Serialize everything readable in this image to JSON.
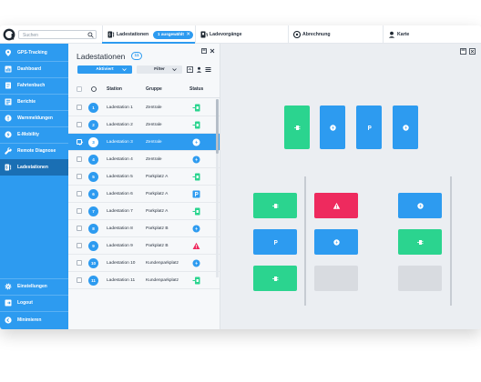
{
  "colors": {
    "accent": "#2d9bf0",
    "accent_dark": "#1a6fb4",
    "green": "#2bd48f",
    "red": "#ee2a5e",
    "gray": "#d8dbe0"
  },
  "topbar": {
    "search_placeholder": "Suchen",
    "tabs": [
      {
        "label": "Ladestationen",
        "icon": "charger-icon",
        "badge": "1 ausgewählt"
      },
      {
        "label": "Ladevorgänge",
        "icon": "plug-icon"
      },
      {
        "label": "Abrechnung",
        "icon": "coin-icon"
      },
      {
        "label": "Karte",
        "icon": "map-pin-icon"
      }
    ]
  },
  "sidebar": {
    "items": [
      {
        "label": "GPS-Tracking",
        "icon": "location-pin-icon"
      },
      {
        "label": "Dashboard",
        "icon": "dashboard-icon"
      },
      {
        "label": "Fahrtenbuch",
        "icon": "logbook-icon"
      },
      {
        "label": "Berichte",
        "icon": "report-icon"
      },
      {
        "label": "Warnmeldungen",
        "icon": "alert-icon"
      },
      {
        "label": "E-Mobility",
        "icon": "lightning-icon"
      },
      {
        "label": "Remote Diagnose",
        "icon": "wrench-icon"
      },
      {
        "label": "Ladestationen",
        "icon": "charger-icon",
        "active": true
      }
    ],
    "bottom": [
      {
        "label": "Einstellungen",
        "icon": "gear-icon"
      },
      {
        "label": "Logout",
        "icon": "logout-icon"
      },
      {
        "label": "Minimieren",
        "icon": "collapse-icon"
      }
    ]
  },
  "panel": {
    "title": "Ladestationen",
    "count": "11",
    "filter_active": "Aktiviert",
    "filter": "Filter",
    "columns": {
      "station": "Station",
      "gruppe": "Gruppe",
      "status": "Status"
    },
    "rows": [
      {
        "num": "1",
        "station": "Ladestation 1",
        "gruppe": "Zentrale",
        "status": "green"
      },
      {
        "num": "2",
        "station": "Ladestation 2",
        "gruppe": "Zentrale",
        "status": "green"
      },
      {
        "num": "3",
        "station": "Ladestation 3",
        "gruppe": "Zentrale",
        "status": "blue",
        "selected": true
      },
      {
        "num": "4",
        "station": "Ladestation 4",
        "gruppe": "Zentrale",
        "status": "blue"
      },
      {
        "num": "5",
        "station": "Ladestation 5",
        "gruppe": "Parkplatz A",
        "status": "green"
      },
      {
        "num": "6",
        "station": "Ladestation 6",
        "gruppe": "Parkplatz A",
        "status": "blue-p"
      },
      {
        "num": "7",
        "station": "Ladestation 7",
        "gruppe": "Parkplatz A",
        "status": "green"
      },
      {
        "num": "8",
        "station": "Ladestation 8",
        "gruppe": "Parkplatz B",
        "status": "blue"
      },
      {
        "num": "9",
        "station": "Ladestation 9",
        "gruppe": "Parkplatz B",
        "status": "red"
      },
      {
        "num": "10",
        "station": "Ladestation 10",
        "gruppe": "Kundenparkplatz",
        "status": "blue"
      },
      {
        "num": "11",
        "station": "Ladestation 11",
        "gruppe": "Kundenparkplatz",
        "status": "green"
      }
    ]
  },
  "map": {
    "spots": [
      {
        "name": "map-spot-green-top",
        "status": "green"
      },
      {
        "name": "map-spot-blue-top-2",
        "status": "blue"
      },
      {
        "name": "map-spot-blue-p-top-3",
        "status": "blue-p"
      },
      {
        "name": "map-spot-blue-top-4",
        "status": "blue"
      },
      {
        "name": "map-spot-green-left-1",
        "status": "green"
      },
      {
        "name": "map-spot-red-alert",
        "status": "red"
      },
      {
        "name": "map-spot-blue-right-1",
        "status": "blue"
      },
      {
        "name": "map-spot-blue-p-left-2",
        "status": "blue-p"
      },
      {
        "name": "map-spot-blue-mid-2",
        "status": "blue"
      },
      {
        "name": "map-spot-green-right-2",
        "status": "green"
      },
      {
        "name": "map-spot-green-left-3",
        "status": "green"
      },
      {
        "name": "map-spot-empty-mid-3",
        "status": "gray"
      },
      {
        "name": "map-spot-empty-right-3",
        "status": "gray"
      }
    ]
  }
}
